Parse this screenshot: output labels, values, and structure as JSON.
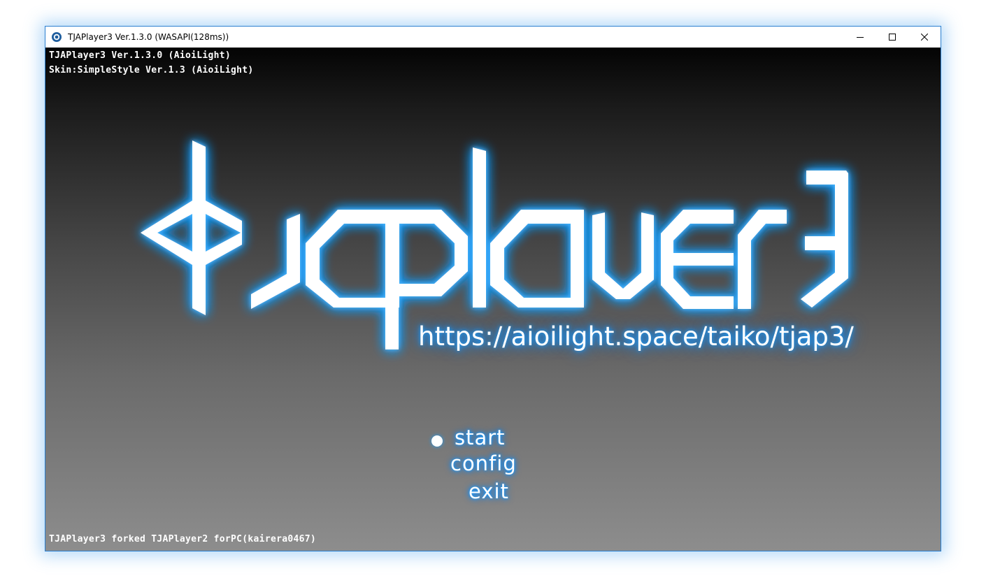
{
  "window": {
    "title": "TJAPlayer3 Ver.1.3.0 (WASAPI(128ms))",
    "controls": [
      "minimize-icon",
      "maximize-icon",
      "close-icon"
    ]
  },
  "info": {
    "version_line": "TJAPlayer3 Ver.1.3.0 (AioiLight)",
    "skin_line": "Skin:SimpleStyle Ver.1.3 (AioiLight)",
    "credit_line": "TJAPlayer3 forked TJAPlayer2 forPC(kairera0467)"
  },
  "logo": {
    "text": "tjaplayer3",
    "url": "https://aioilight.space/taiko/tjap3/",
    "glow_color": "#1a9cff"
  },
  "menu": {
    "items": [
      {
        "label": "start",
        "selected": true
      },
      {
        "label": "config",
        "selected": false
      },
      {
        "label": "exit",
        "selected": false
      }
    ]
  }
}
